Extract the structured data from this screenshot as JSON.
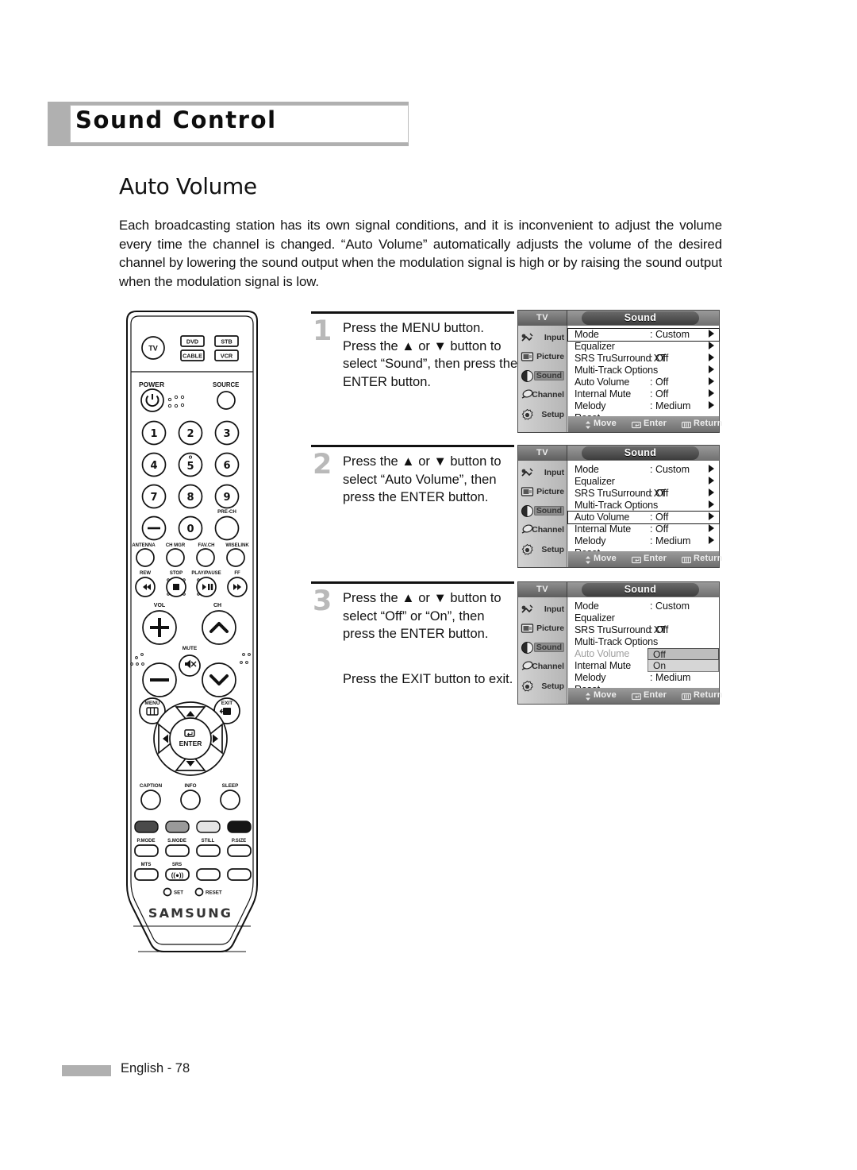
{
  "header": {
    "title": "Sound Control"
  },
  "section": {
    "title": "Auto Volume"
  },
  "intro": "Each broadcasting station has its own signal conditions, and it is inconvenient to adjust the volume every time the channel is changed. “Auto Volume” automatically adjusts the volume of the desired channel by lowering the sound output when the modulation signal is high or by raising the sound output when the modulation signal is low.",
  "steps": [
    {
      "number": "1",
      "text": "Press the MENU button. Press the ▲ or ▼ button to select “Sound”, then press the ENTER button.",
      "text2": ""
    },
    {
      "number": "2",
      "text": "Press the ▲ or ▼ button to select “Auto Volume”, then press the ENTER button.",
      "text2": ""
    },
    {
      "number": "3",
      "text": "Press the ▲ or ▼ button to select “Off” or “On”, then press the ENTER button.",
      "text2": "Press the EXIT button to exit."
    }
  ],
  "osd": {
    "source_label": "TV",
    "title": "Sound",
    "sidebar": [
      {
        "label": "Input",
        "icon": "input-icon"
      },
      {
        "label": "Picture",
        "icon": "picture-icon"
      },
      {
        "label": "Sound",
        "icon": "sound-icon"
      },
      {
        "label": "Channel",
        "icon": "channel-icon"
      },
      {
        "label": "Setup",
        "icon": "setup-icon"
      }
    ],
    "active_sidebar": "Sound",
    "rows": [
      {
        "label": "Mode",
        "value": ": Custom"
      },
      {
        "label": "Equalizer",
        "value": ""
      },
      {
        "label": "SRS TruSurround XT",
        "value": ": Off"
      },
      {
        "label": "Multi-Track Options",
        "value": ""
      },
      {
        "label": "Auto Volume",
        "value": ": Off"
      },
      {
        "label": "Internal Mute",
        "value": ": Off"
      },
      {
        "label": "Melody",
        "value": ": Medium"
      },
      {
        "label": "Reset",
        "value": ""
      }
    ],
    "help": [
      {
        "label": "Move",
        "icon": "updown-arrows-icon"
      },
      {
        "label": "Enter",
        "icon": "enter-key-icon"
      },
      {
        "label": "Return",
        "icon": "return-key-icon"
      }
    ],
    "dropdown": {
      "options": [
        "Off",
        "On"
      ],
      "selected": "Off"
    },
    "panel1_selected_row": "Mode",
    "panel2_selected_row": "Auto Volume",
    "panel3_dimmed_row": "Auto Volume"
  },
  "remote": {
    "brand": "SAMSUNG",
    "device_buttons": [
      "TV",
      "DVD",
      "STB",
      "CABLE",
      "VCR"
    ],
    "power_label": "POWER",
    "source_label": "SOURCE",
    "numbers": [
      "1",
      "2",
      "3",
      "4",
      "5",
      "6",
      "7",
      "8",
      "9",
      "—",
      "0",
      ""
    ],
    "pre_ch_label": "PRE-CH",
    "row_labels_1": [
      "ANTENNA",
      "CH MGR",
      "FAV.CH",
      "WISELINK"
    ],
    "row_labels_2": [
      "REW",
      "STOP",
      "PLAY/PAUSE",
      "FF"
    ],
    "vol_label": "VOL",
    "ch_label": "CH",
    "mute_label": "MUTE",
    "menu_label": "MENU",
    "exit_label": "EXIT",
    "enter_label": "ENTER",
    "bottom_labels_1": [
      "CAPTION",
      "INFO",
      "SLEEP"
    ],
    "color_labels": [
      "P.MODE",
      "S.MODE",
      "STILL",
      "P.SIZE"
    ],
    "bottom_labels_2": [
      "MTS",
      "SRS"
    ],
    "set_label": "SET",
    "reset_label": "RESET"
  },
  "footer": {
    "page": "English - 78"
  }
}
